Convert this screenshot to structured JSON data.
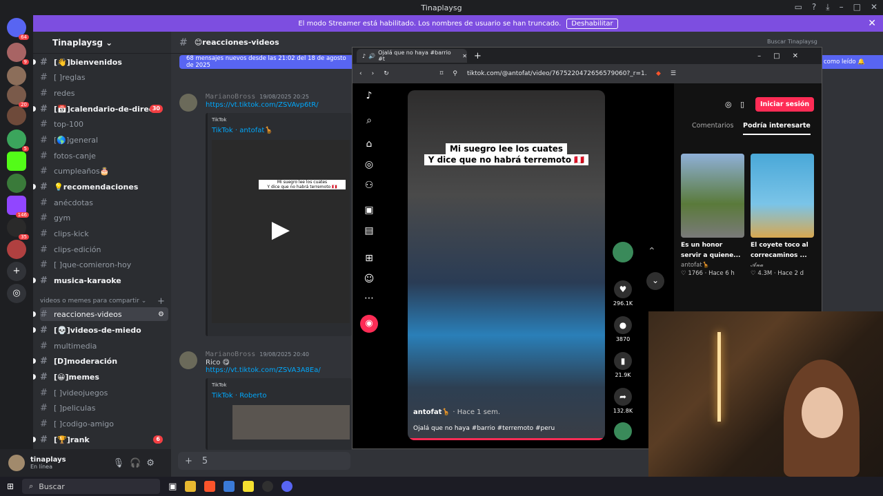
{
  "window": {
    "title": "Tinaplaysg"
  },
  "streamer_banner": {
    "text": "El modo Streamer está habilitado. Los nombres de usuario se han truncado.",
    "button": "Deshabilitar"
  },
  "server_badges": [
    "64",
    "9",
    "20",
    "5",
    "146",
    "35"
  ],
  "server": {
    "name": "Tinaplaysg"
  },
  "channels": [
    {
      "name": "[👋]bienvenidos",
      "bright": true
    },
    {
      "name": "[ ]reglas"
    },
    {
      "name": "redes"
    },
    {
      "name": "[📅]calendario-de-directo",
      "bright": true,
      "badge": "30"
    },
    {
      "name": "top-100"
    },
    {
      "name": "[🌎]general"
    },
    {
      "name": "fotos-canje"
    },
    {
      "name": "cumpleaños🎂"
    },
    {
      "name": "💡recomendaciones",
      "bright": true
    },
    {
      "name": "anécdotas"
    },
    {
      "name": "gym"
    },
    {
      "name": "clips-kick"
    },
    {
      "name": "clips-edición"
    },
    {
      "name": "[ ]que-comieron-hoy"
    },
    {
      "name": "musica-karaoke",
      "bright": true
    }
  ],
  "category": "videos o memes para compartir",
  "channels2": [
    {
      "name": "reacciones-videos",
      "active": true
    },
    {
      "name": "[💀]videos-de-miedo",
      "bright": true
    },
    {
      "name": "multimedia"
    },
    {
      "name": "[D]moderación",
      "bright": true
    },
    {
      "name": "[😀]memes",
      "bright": true
    },
    {
      "name": "[ ]videojuegos"
    },
    {
      "name": "[ ]peliculas"
    },
    {
      "name": "[ ]codigo-amigo"
    },
    {
      "name": "[🏆]rank",
      "bright": true,
      "badge": "6"
    }
  ],
  "user": {
    "name": "tinaplays",
    "status": "En línea"
  },
  "chat": {
    "channel": "😊reacciones-videos",
    "new_messages": "68 mensajes nuevos desde las 21:02 del 18 de agosto de 2025",
    "mark_read": "como leído",
    "messages": [
      {
        "author": "MarianoBross",
        "time": "19/08/2025 20:25",
        "link": "https://vt.tiktok.com/ZSVAvp6tR/",
        "provider": "TikTok",
        "embed_title": "TikTok · antofat🦒"
      },
      {
        "author": "MarianoBross",
        "time": "19/08/2025 20:40",
        "text": "Rico 😋",
        "link": "https://vt.tiktok.com/ZSVA3A8Ea/",
        "provider": "TikTok",
        "embed_title": "TikTok · Roberto"
      }
    ],
    "input_value": "5"
  },
  "browser": {
    "tab_title": "Ojalá que no haya #barrio #t",
    "url": "tiktok.com/@antofat/video/7675220472656579060?_r=1...",
    "search_placeholder": "Buscar Tinaplaysg"
  },
  "tiktok": {
    "caption_line1": "Mi suegro lee los cuates",
    "caption_line2": "Y dice que no habrá terremoto 🇵🇪",
    "author": "antofat🦒",
    "time": "· Hace 1 sem.",
    "description": "Ojalá que no haya #barrio #terremoto #peru",
    "likes": "296.1K",
    "comments": "3870",
    "saves": "21.9K",
    "shares": "132.8K",
    "login_button": "Iniciar sesión",
    "tab_comments": "Comentarios",
    "tab_related": "Podría interesarte",
    "related": [
      {
        "title": "Es un honor servir a quiene...",
        "author": "antofat🦒",
        "likes": "1766",
        "time": "Hace 6 h"
      },
      {
        "title": "El coyete toco al correcaminos ...",
        "author": "𝓐𝓷𝓪",
        "likes": "4.3M",
        "time": "Hace 2 d"
      }
    ]
  },
  "taskbar": {
    "search": "Buscar"
  }
}
